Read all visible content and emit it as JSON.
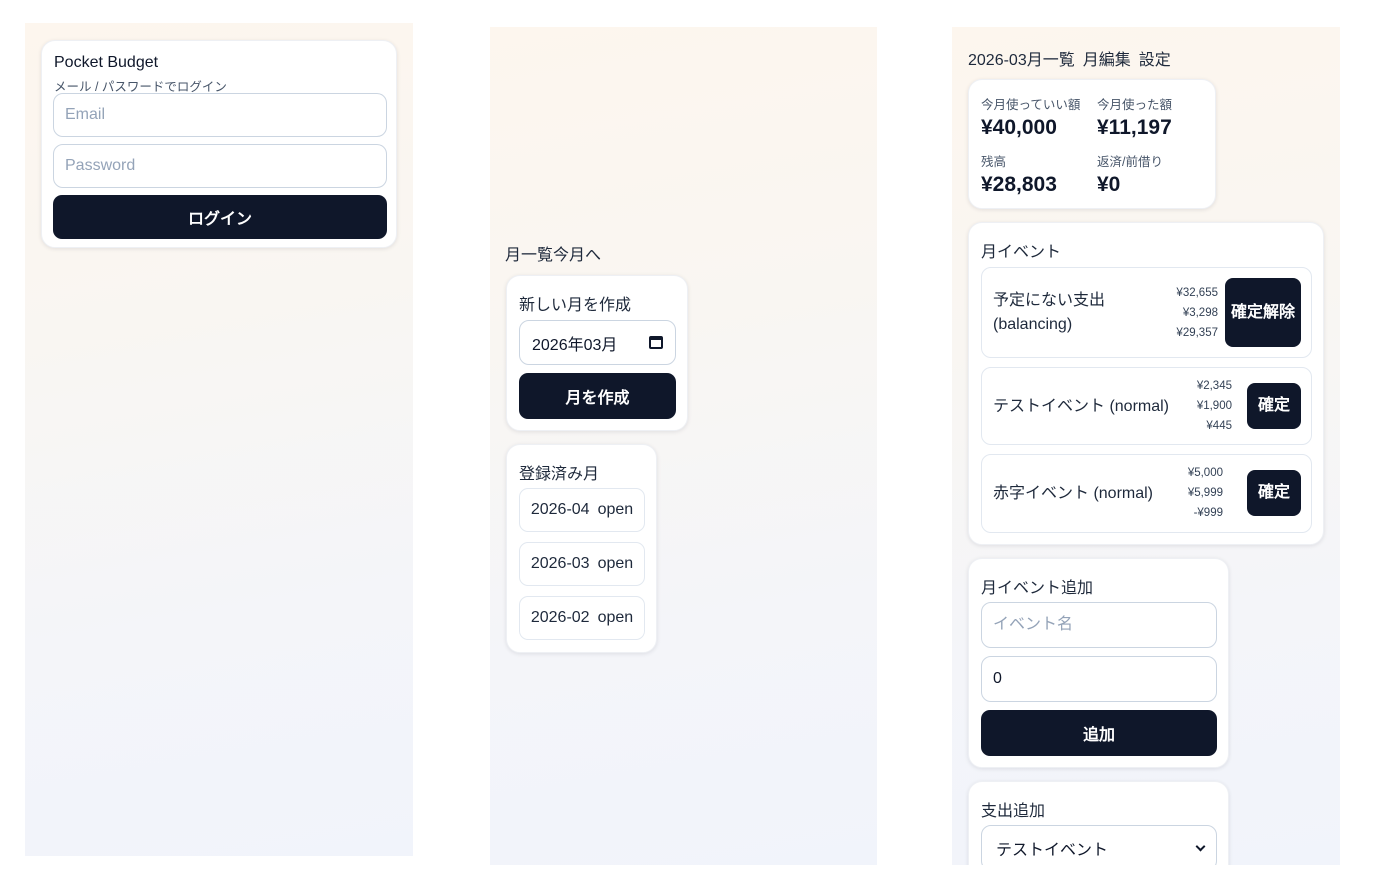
{
  "login": {
    "title": "Pocket Budget",
    "subtitle": "メール / パスワードでログイン",
    "email_placeholder": "Email",
    "password_placeholder": "Password",
    "login_button": "ログイン"
  },
  "months": {
    "header": "月一覧今月へ",
    "create_card": {
      "title": "新しい月を作成",
      "month_value": "2026年03月",
      "create_button": "月を作成"
    },
    "registered_card": {
      "title": "登録済み月",
      "items": [
        {
          "month": "2026-04",
          "status": "open"
        },
        {
          "month": "2026-03",
          "status": "open"
        },
        {
          "month": "2026-02",
          "status": "open"
        }
      ]
    }
  },
  "dashboard": {
    "nav": {
      "month_list": "2026-03月一覧",
      "month_edit": "月編集",
      "settings": "設定"
    },
    "summary": {
      "budget_label": "今月使っていい額",
      "budget_value": "¥40,000",
      "spent_label": "今月使った額",
      "spent_value": "¥11,197",
      "balance_label": "残高",
      "balance_value": "¥28,803",
      "repay_label": "返済/前借り",
      "repay_value": "¥0"
    },
    "events": {
      "title": "月イベント",
      "items": [
        {
          "name": "予定にない支出 (balancing)",
          "amount1": "¥32,655",
          "amount2": "¥3,298",
          "amount3": "¥29,357",
          "button": "確定解除"
        },
        {
          "name": "テストイベント (normal)",
          "amount1": "¥2,345",
          "amount2": "¥1,900",
          "amount3": "¥445",
          "button": "確定"
        },
        {
          "name": "赤字イベント (normal)",
          "amount1": "¥5,000",
          "amount2": "¥5,999",
          "amount3": "-¥999",
          "button": "確定"
        }
      ]
    },
    "add_event": {
      "title": "月イベント追加",
      "name_placeholder": "イベント名",
      "amount_value": "0",
      "add_button": "追加"
    },
    "expense": {
      "title": "支出追加",
      "selected_event": "テストイベント"
    }
  }
}
